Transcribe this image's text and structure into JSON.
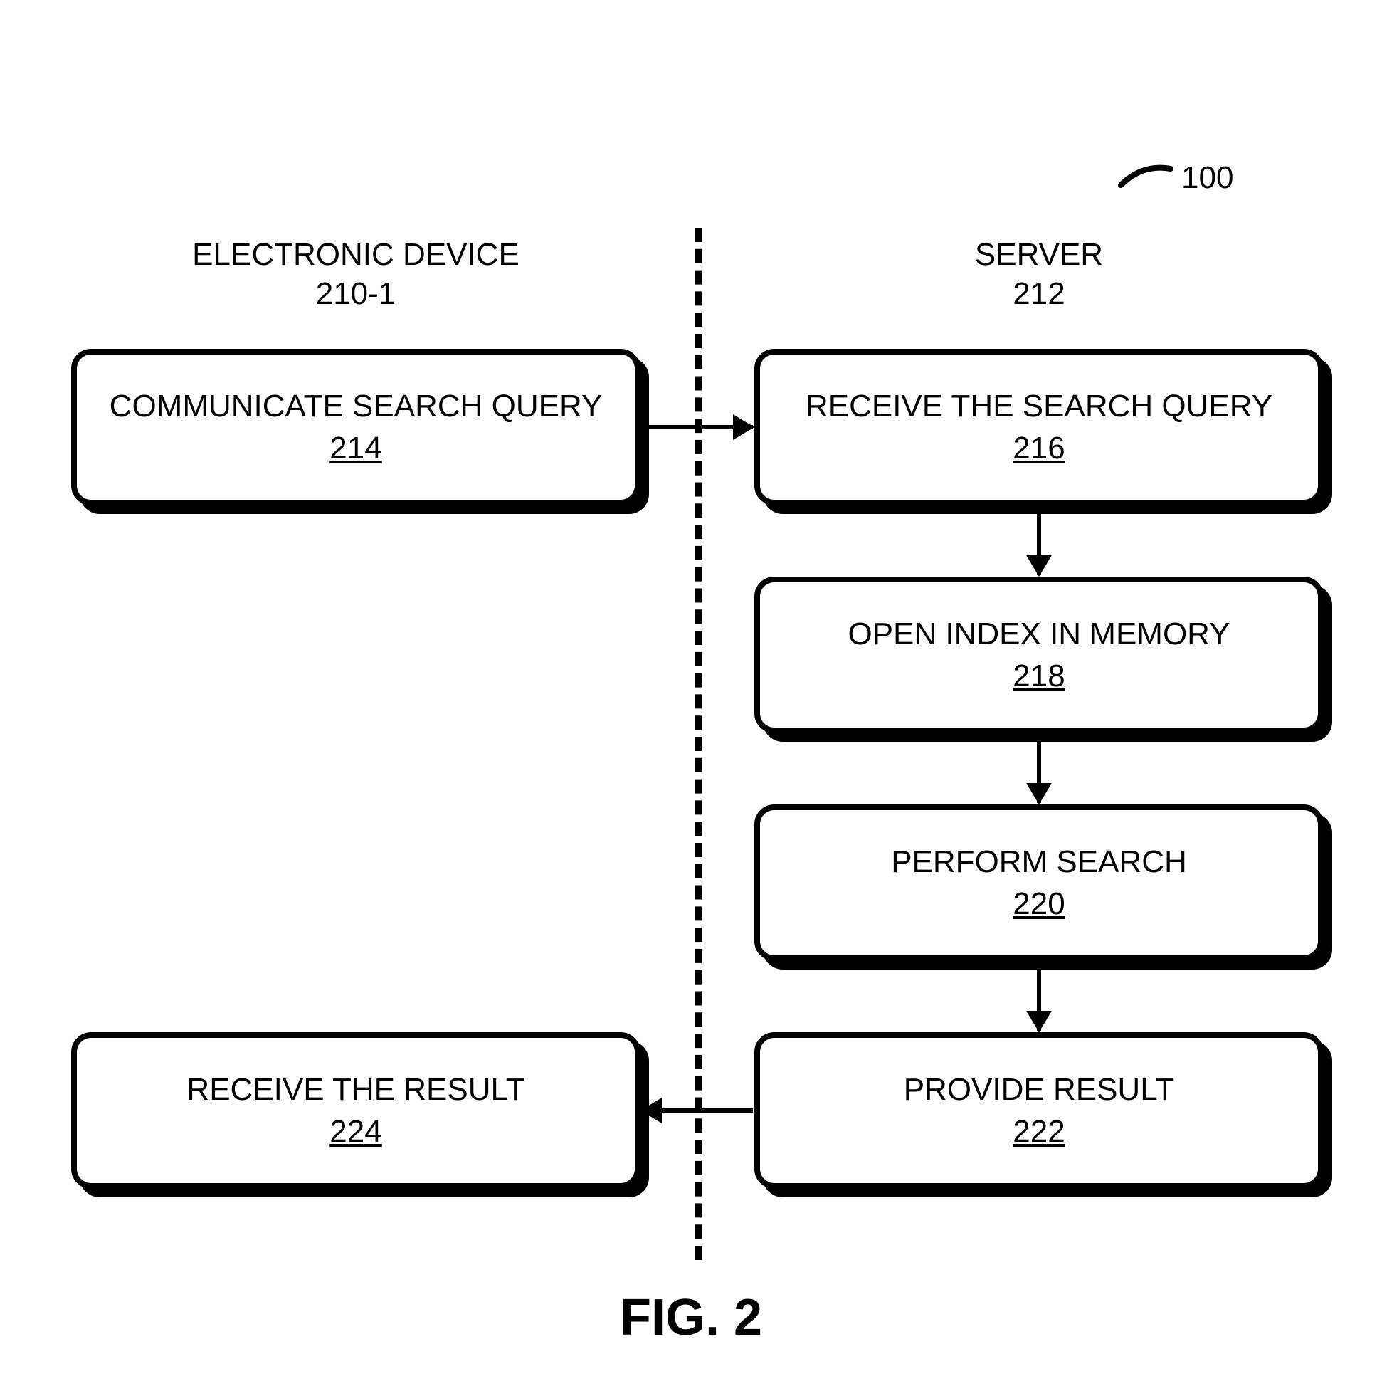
{
  "reference_number": "100",
  "left_column": {
    "heading_line1": "ELECTRONIC DEVICE",
    "heading_line2": "210-1"
  },
  "right_column": {
    "heading_line1": "SERVER",
    "heading_line2": "212"
  },
  "boxes": {
    "communicate": {
      "title": "COMMUNICATE SEARCH QUERY",
      "num": "214"
    },
    "receive_query": {
      "title": "RECEIVE THE SEARCH QUERY",
      "num": "216"
    },
    "open_index": {
      "title": "OPEN INDEX IN MEMORY",
      "num": "218"
    },
    "perform_search": {
      "title": "PERFORM SEARCH",
      "num": "220"
    },
    "provide_result": {
      "title": "PROVIDE RESULT",
      "num": "222"
    },
    "receive_result": {
      "title": "RECEIVE THE RESULT",
      "num": "224"
    }
  },
  "caption": "FIG. 2"
}
